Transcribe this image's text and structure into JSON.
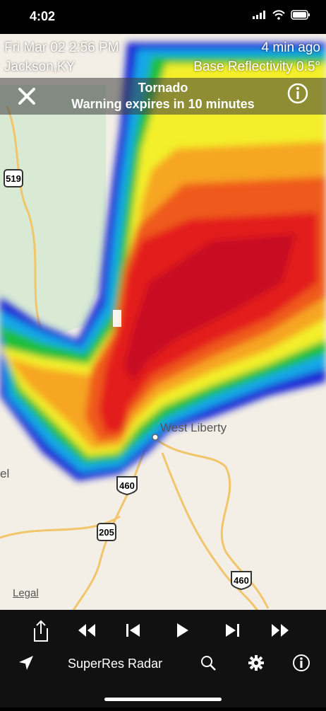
{
  "status_bar": {
    "time": "4:02"
  },
  "overlay": {
    "date": "Fri Mar 02 2:56 PM",
    "location": "Jackson,KY",
    "age": "4 min ago",
    "product": "Base Reflectivity 0.5°"
  },
  "warning": {
    "title": "Tornado",
    "subtitle": "Warning expires in 10 minutes"
  },
  "map": {
    "places": {
      "west_liberty": "West Liberty",
      "clearfield_partial": "Clearfield",
      "partial_l": "el"
    },
    "route_shields": [
      "519",
      "460",
      "205",
      "460"
    ],
    "legal": "Legal"
  },
  "toolbar": {
    "app_title": "SuperRes Radar"
  },
  "icons": [
    "share-icon",
    "rewind-icon",
    "skip-back-icon",
    "play-icon",
    "skip-forward-icon",
    "fast-forward-icon",
    "location-arrow-icon",
    "search-icon",
    "gear-icon",
    "info-icon",
    "close-icon"
  ]
}
